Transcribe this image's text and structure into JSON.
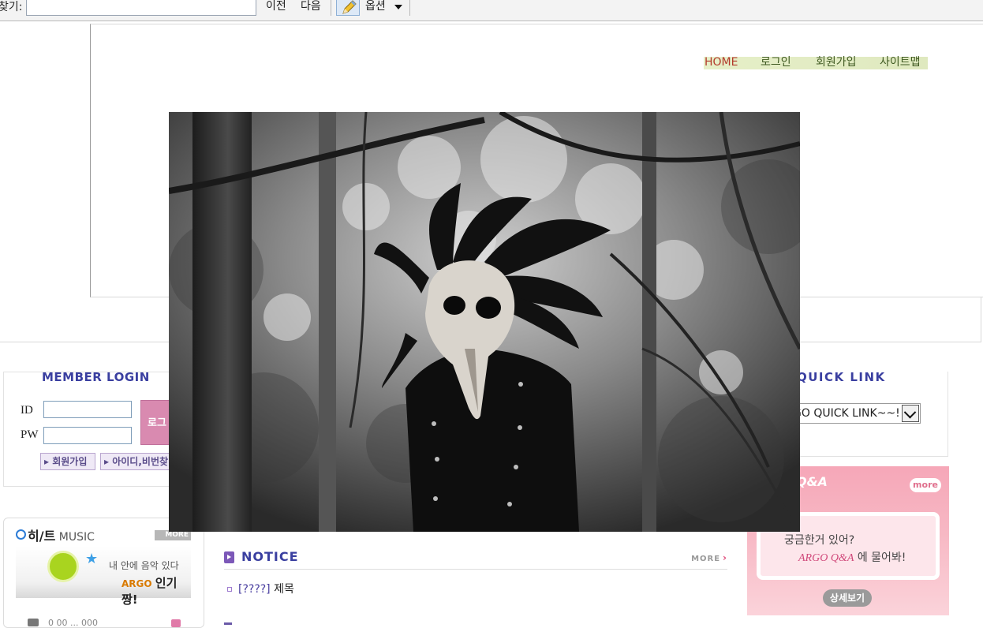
{
  "findbar": {
    "label": "찾기:",
    "input_value": "",
    "prev_label": "이전",
    "next_label": "다음",
    "options_label": "옵션"
  },
  "topnav": {
    "home": "HOME",
    "login": "로그인",
    "join": "회원가입",
    "sitemap": "사이트맵"
  },
  "login": {
    "title": "MEMBER LOGIN",
    "id_label": "ID",
    "pw_label": "PW",
    "login_button": "로그",
    "signup_button": "회원가입",
    "find_button": "아이디,비번찾"
  },
  "quicklink": {
    "title": "QUICK LINK",
    "selected": "GO QUICK LINK~~!"
  },
  "qa": {
    "title": "Q&A",
    "more": "more",
    "line1": "궁금한거 있어?",
    "brand": "ARGO Q&A",
    "line2_suffix": " 에 물어봐!",
    "detail_button": "상세보기"
  },
  "music": {
    "title": "히/트",
    "title_suffix": " MUSIC",
    "more": "MORE",
    "banner_line1": "내 안에 음악 있다",
    "banner_brand": "ARGO",
    "banner_pop": "인기짱!",
    "row_text": "0 00 ... 000"
  },
  "notice": {
    "title": "NOTICE",
    "more": "MORE",
    "items": [
      {
        "tag": "[????]",
        "title": "제목"
      }
    ]
  },
  "photo": {
    "subject": "plague-mask-figure-in-forest",
    "colors": {
      "dark": "#111111",
      "mid": "#6f6f6f",
      "light": "#d9d9d9"
    }
  }
}
